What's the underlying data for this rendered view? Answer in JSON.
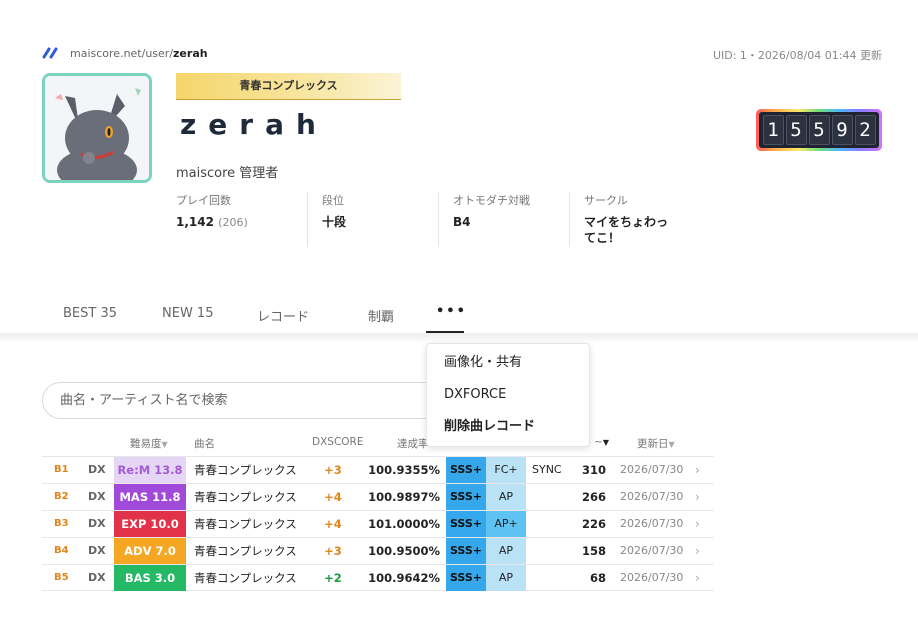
{
  "header": {
    "url_host": "maiscore.net/user/",
    "url_user": "zerah",
    "uid_text": "UID: 1・2026/08/04 01:44 更新"
  },
  "profile": {
    "title_plate": "青春コンプレックス",
    "username": "zerah",
    "role": "maiscore 管理者",
    "stats": [
      {
        "label": "プレイ回数",
        "value": "1,142",
        "sub": "(206)"
      },
      {
        "label": "段位",
        "value": "十段"
      },
      {
        "label": "オトモダチ対戦",
        "value": "B4"
      },
      {
        "label": "サークル",
        "value": "マイをちょわってこ！"
      }
    ],
    "rating_digits": [
      "1",
      "5",
      "5",
      "9",
      "2"
    ]
  },
  "tabs": [
    {
      "label": "BEST 35"
    },
    {
      "label": "NEW 15"
    },
    {
      "label": "レコード"
    },
    {
      "label": "制覇"
    },
    {
      "label": "•••"
    }
  ],
  "dropdown": {
    "items": [
      {
        "label": "画像化・共有"
      },
      {
        "label": "DXFORCE"
      },
      {
        "label": "削除曲レコード"
      }
    ]
  },
  "search": {
    "placeholder": "曲名・アーティスト名で検索"
  },
  "table": {
    "headers": {
      "difficulty": "難易度",
      "song": "曲名",
      "dxscore": "DXSCORE",
      "achievement": "達成率",
      "rating_tail": "~",
      "updated": "更新日"
    },
    "rows": [
      {
        "rank": "B1",
        "type": "DX",
        "diff": "Re:M 13.8",
        "diff_color": "#e6d6f5",
        "diff_text_color": "#a45ad6",
        "song": "青春コンプレックス",
        "dx": "+3",
        "ach": "100.9355%",
        "rank_badge": "SSS+",
        "fc": "FC+",
        "sync": "SYNC",
        "rate": "310",
        "date": "2026/07/30"
      },
      {
        "rank": "B2",
        "type": "DX",
        "diff": "MAS 11.8",
        "diff_color": "#a14ad9",
        "diff_text_color": "#ffffff",
        "song": "青春コンプレックス",
        "dx": "+4",
        "ach": "100.9897%",
        "rank_badge": "SSS+",
        "fc": "AP",
        "sync": "",
        "rate": "266",
        "date": "2026/07/30"
      },
      {
        "rank": "B3",
        "type": "DX",
        "diff": "EXP 10.0",
        "diff_color": "#e2324a",
        "diff_text_color": "#ffffff",
        "song": "青春コンプレックス",
        "dx": "+4",
        "ach": "101.0000%",
        "rank_badge": "SSS+",
        "fc": "AP+",
        "sync": "",
        "rate": "226",
        "date": "2026/07/30"
      },
      {
        "rank": "B4",
        "type": "DX",
        "diff": "ADV 7.0",
        "diff_color": "#f5a623",
        "diff_text_color": "#ffffff",
        "song": "青春コンプレックス",
        "dx": "+3",
        "ach": "100.9500%",
        "rank_badge": "SSS+",
        "fc": "AP",
        "sync": "",
        "rate": "158",
        "date": "2026/07/30"
      },
      {
        "rank": "B5",
        "type": "DX",
        "diff": "BAS 3.0",
        "diff_color": "#25b865",
        "diff_text_color": "#ffffff",
        "song": "青春コンプレックス",
        "dx": "+2",
        "ach": "100.9642%",
        "rank_badge": "SSS+",
        "fc": "AP",
        "sync": "",
        "rate": "68",
        "date": "2026/07/30"
      }
    ]
  }
}
